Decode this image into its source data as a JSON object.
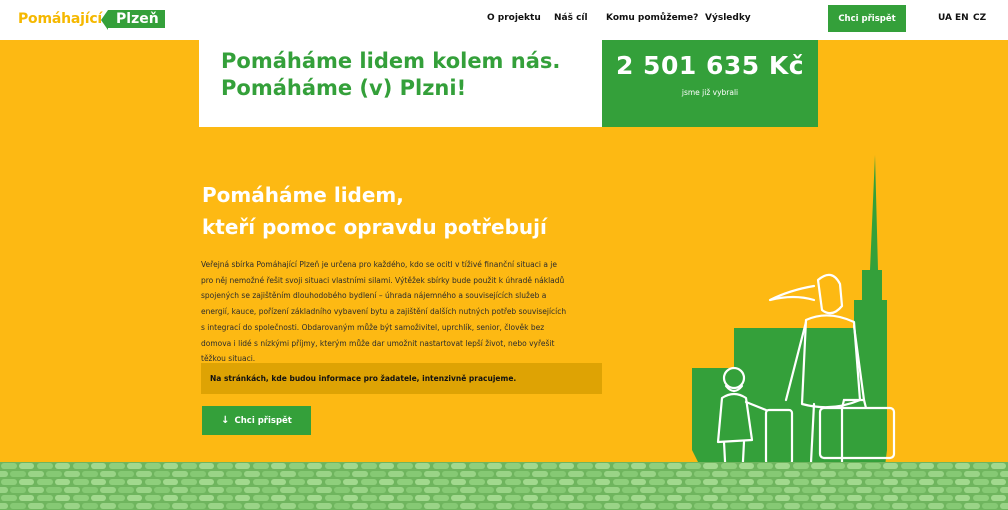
{
  "header": {
    "logo": {
      "name": "Pomáhající",
      "city": "Plzeň"
    },
    "nav": [
      "O projektu",
      "Náš cíl",
      "Komu pomůžeme?",
      "Výsledky"
    ],
    "cta": "Chci přispět",
    "languages": [
      "UA",
      "EN",
      "CZ"
    ]
  },
  "hero": {
    "slogan_line1": "Pomáháme lidem kolem nás.",
    "slogan_line2": "Pomáháme (v) Plzni!",
    "amount": "2 501 635 Kč",
    "amount_caption": "jsme již vybrali"
  },
  "intro": {
    "heading_line1": "Pomáháme lidem,",
    "heading_line2": "kteří pomoc opravdu potřebují",
    "paragraph_lines": [
      "Veřejná sbírka Pomáhající Plzeň je určena pro každého, kdo se ocitl v tíživé finanční situaci a je",
      "pro něj nemožné řešit svoji situaci vlastními silami. Výtěžek sbírky bude použit k úhradě nákladů",
      "spojených se zajištěním dlouhodobého bydlení – úhrada nájemného a souvisejících služeb a",
      "energií, kauce, pořízení základního vybavení bytu a zajištění dalších nutných potřeb souvisejících",
      "s integrací do společnosti. Obdarovaným může být samoživitel, uprchlík, senior, člověk bez",
      "domova i lidé s nízkými příjmy, kterým může dar umožnit nastartovat lepší život, nebo vyřešit",
      "těžkou situaci."
    ],
    "note": "Na stránkách, kde budou informace pro žadatele, intenzivně pracujeme.",
    "cta": "Chci přispět",
    "cta_arrow": "↓"
  },
  "colors": {
    "yellow": "#fdb913",
    "green": "#34a03a",
    "note_background": "#dea304",
    "pavement": "#7cc06b"
  },
  "icons": [
    "arrow-down-icon"
  ]
}
